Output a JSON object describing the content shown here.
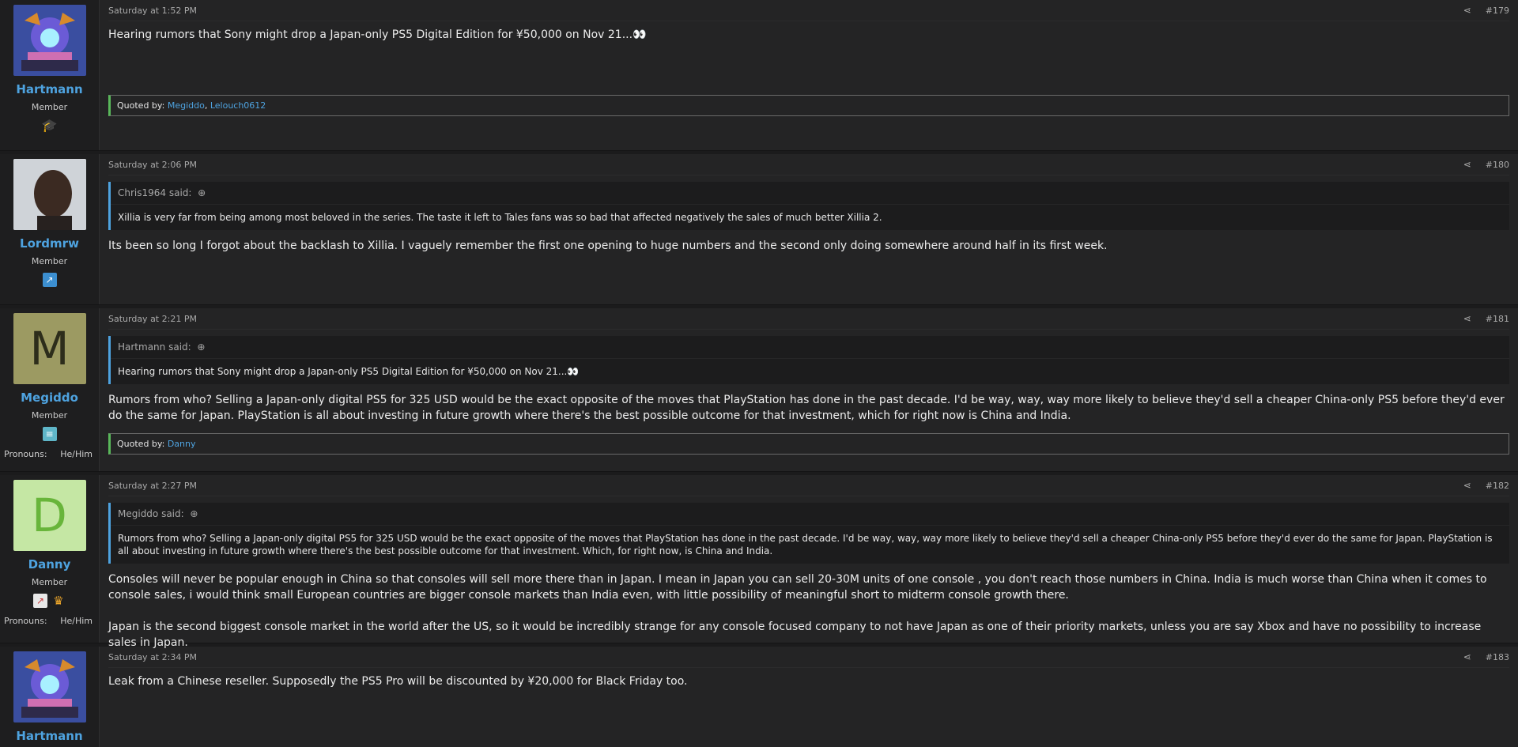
{
  "posts": [
    {
      "time": "Saturday at 1:52 PM",
      "num": "#179",
      "user": {
        "name": "Hartmann",
        "role": "Member"
      },
      "body": "Hearing rumors that Sony might drop a Japan-only PS5 Digital Edition for ¥50,000 on Nov 21...",
      "quoted_by_label": "Quoted by:",
      "quoted_by": [
        "Megiddo",
        "Lelouch0612"
      ]
    },
    {
      "time": "Saturday at 2:06 PM",
      "num": "#180",
      "user": {
        "name": "Lordmrw",
        "role": "Member"
      },
      "quote": {
        "author": "Chris1964 said:",
        "text": "Xillia is very far from being among most beloved in the series. The taste it left to Tales fans was so bad that affected negatively the sales of much better Xillia 2."
      },
      "body": "Its been so long I forgot about the backlash to Xillia. I vaguely remember the first one opening to huge numbers and the second only doing somewhere around half in its first week."
    },
    {
      "time": "Saturday at 2:21 PM",
      "num": "#181",
      "user": {
        "name": "Megiddo",
        "role": "Member",
        "letter": "M",
        "pronouns_label": "Pronouns:",
        "pronouns": "He/Him"
      },
      "quote": {
        "author": "Hartmann said:",
        "text": "Hearing rumors that Sony might drop a Japan-only PS5 Digital Edition for ¥50,000 on Nov 21..."
      },
      "body": "Rumors from who? Selling a Japan-only digital PS5 for 325 USD would be the exact opposite of the moves that PlayStation has done in the past decade. I'd be way, way, way more likely to believe they'd sell a cheaper China-only PS5 before they'd ever do the same for Japan. PlayStation is all about investing in future growth where there's the best possible outcome for that investment, which for right now is China and India.",
      "quoted_by_label": "Quoted by:",
      "quoted_by": [
        "Danny"
      ]
    },
    {
      "time": "Saturday at 2:27 PM",
      "num": "#182",
      "user": {
        "name": "Danny",
        "role": "Member",
        "letter": "D",
        "pronouns_label": "Pronouns:",
        "pronouns": "He/Him"
      },
      "quote": {
        "author": "Megiddo said:",
        "text": "Rumors from who? Selling a Japan-only digital PS5 for 325 USD would be the exact opposite of the moves that PlayStation has done in the past decade. I'd be way, way, way more likely to believe they'd sell a cheaper China-only PS5 before they'd ever do the same for Japan. PlayStation is all about investing in future growth where there's the best possible outcome for that investment. Which, for right now, is China and India."
      },
      "body": "Consoles will never be popular enough in China so that consoles will sell more there than in Japan. I mean in Japan you can sell 20-30M units of one console , you don't reach those numbers in China. India is much worse than China when it comes to console sales, i would think small European countries are bigger console markets than India even, with little possibility of meaningful short to midterm console growth there.",
      "body2": "Japan is the second biggest console market in the world after the US, so it would be incredibly strange for any console focused company to not have Japan as one of their priority markets, unless you are say Xbox and have no possibility to increase sales in Japan."
    },
    {
      "time": "Saturday at 2:34 PM",
      "num": "#183",
      "user": {
        "name": "Hartmann"
      },
      "body": "Leak from a Chinese reseller. Supposedly the PS5 Pro will be discounted by ¥20,000 for Black Friday too."
    }
  ],
  "icons": {
    "share": "share-icon",
    "jump": "arrow-up-circle-icon",
    "eyes": "eyes-emoji"
  },
  "colors": {
    "link": "#4ea3e0",
    "quoted_by_accent": "#59b85a",
    "avatar_m_bg": "#9c9a62",
    "avatar_d_bg": "#c5e7a4",
    "avatar_d_fg": "#68b53a"
  }
}
